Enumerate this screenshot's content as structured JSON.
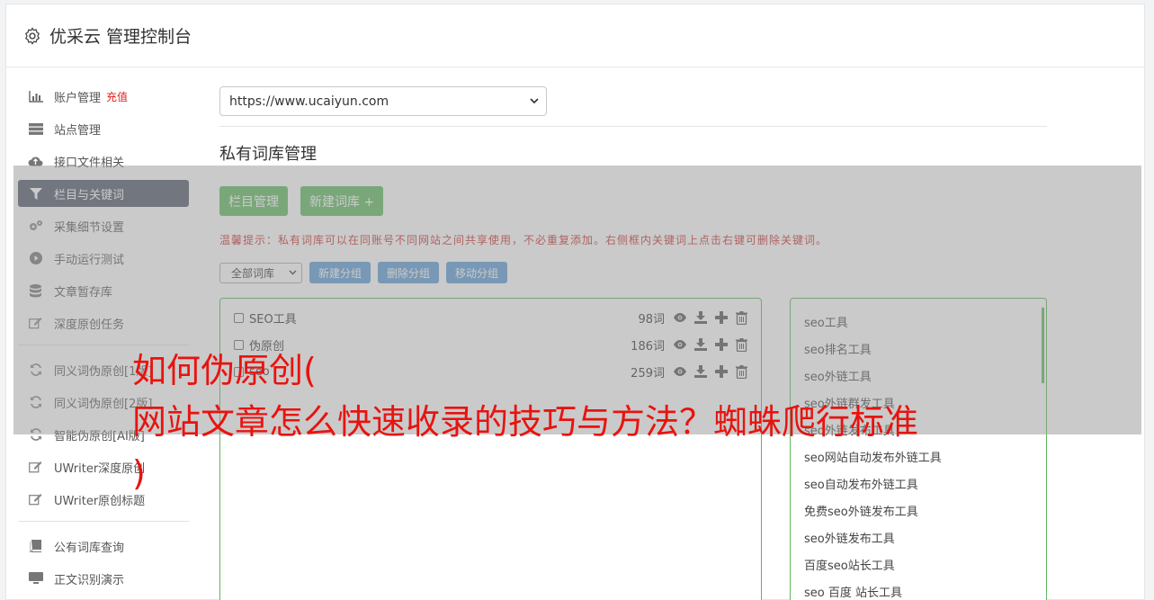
{
  "header": {
    "title": "优采云 管理控制台"
  },
  "sidebar": {
    "items": [
      {
        "label": "账户管理",
        "extra": "充值",
        "icon": "bar-chart-icon"
      },
      {
        "label": "站点管理",
        "icon": "server-icon"
      },
      {
        "label": "接口文件相关",
        "icon": "cloud-upload-icon"
      },
      {
        "label": "栏目与关键词",
        "icon": "filter-icon",
        "active": true
      },
      {
        "label": "采集细节设置",
        "icon": "cogs-icon"
      },
      {
        "label": "手动运行测试",
        "icon": "play-circle-icon"
      },
      {
        "label": "文章暂存库",
        "icon": "database-icon"
      },
      {
        "label": "深度原创任务",
        "icon": "edit-icon"
      }
    ],
    "items2": [
      {
        "label": "同义词伪原创[1版]",
        "icon": "refresh-icon"
      },
      {
        "label": "同义词伪原创[2版]",
        "icon": "refresh-icon"
      },
      {
        "label": "智能伪原创[AI版]",
        "icon": "refresh-icon"
      },
      {
        "label": "UWriter深度原创",
        "icon": "edit-icon"
      },
      {
        "label": "UWriter原创标题",
        "icon": "edit-icon"
      }
    ],
    "items3": [
      {
        "label": "公有词库查询",
        "icon": "book-icon"
      },
      {
        "label": "正文识别演示",
        "icon": "monitor-icon"
      }
    ]
  },
  "main": {
    "site_select": "https://www.ucaiyun.com",
    "section_title": "私有词库管理",
    "btn_columns": "栏目管理",
    "btn_new_lib": "新建词库 +",
    "tip": "温馨提示：私有词库可以在同账号不同网站之间共享使用，不必重复添加。右侧框内关键词上点击右键可删除关键词。",
    "lib_filter": "全部词库",
    "btn_new_group": "新建分组",
    "btn_delete_group": "删除分组",
    "btn_move_group": "移动分组",
    "libraries": [
      {
        "name": "SEO工具",
        "count": "98词"
      },
      {
        "name": "伪原创",
        "count": "186词"
      },
      {
        "name": "seo",
        "count": "259词"
      }
    ],
    "keywords": [
      "seo工具",
      "seo排名工具",
      "seo外链工具",
      "seo外链群发工具",
      "seo外链发布工具",
      "seo网站自动发布外链工具",
      "seo自动发布外链工具",
      "免费seo外链发布工具",
      "seo外链发布工具",
      "百度seo站长工具",
      "seo 百度 站长工具"
    ]
  },
  "overlay": {
    "line1": "如何伪原创(",
    "line2": "网站文章怎么快速收录的技巧与方法？蜘蛛爬行标准",
    "line3": ")"
  },
  "colors": {
    "accent_green": "#5cb85c",
    "active_nav": "#4e5668",
    "blue_btn": "#5b9bd5",
    "headline_red": "#e8130f"
  }
}
